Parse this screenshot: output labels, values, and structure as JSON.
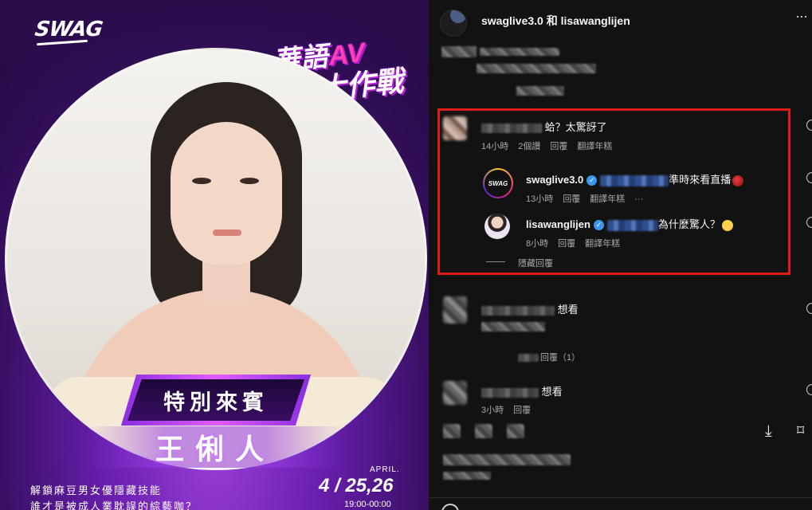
{
  "poster": {
    "logo": "SWAG",
    "event_title_line1": "華語",
    "event_title_av": "AV",
    "event_title_line2": "復興大作戰",
    "special_label": "特別來賓",
    "guest_name": "王俐人",
    "tagline1": "解鎖麻豆男女優隱藏技能",
    "tagline2": "誰才是被成人業耽誤的綜藝咖？",
    "date_month": "APRIL.",
    "date_main": "4 / 25,26",
    "date_time": "19:00-00:00"
  },
  "header": {
    "title": "swaglive3.0 和 lisawanglijen",
    "more_label": "···"
  },
  "highlighted_comment": {
    "text": "蛤？太驚訝了",
    "time": "14小時",
    "likes": "2個讚",
    "reply_label": "回覆",
    "translate_label": "翻譯年糕"
  },
  "replies": [
    {
      "username": "swaglive3.0",
      "avatar_text": "SWAG",
      "text": "準時來看直播",
      "time": "13小時",
      "reply_label": "回覆",
      "translate_label": "翻譯年糕",
      "more_label": "···"
    },
    {
      "username": "lisawanglijen",
      "text": "為什麼驚人？",
      "time": "8小時",
      "reply_label": "回覆",
      "translate_label": "翻譯年糕"
    }
  ],
  "hide_replies_label": "隱藏回覆",
  "comment_want1": "想看",
  "comment_want1_reply": "回覆（1）",
  "comment_want2": "想看",
  "comment_want2_time": "3小時",
  "comment_want2_reply": "回覆"
}
